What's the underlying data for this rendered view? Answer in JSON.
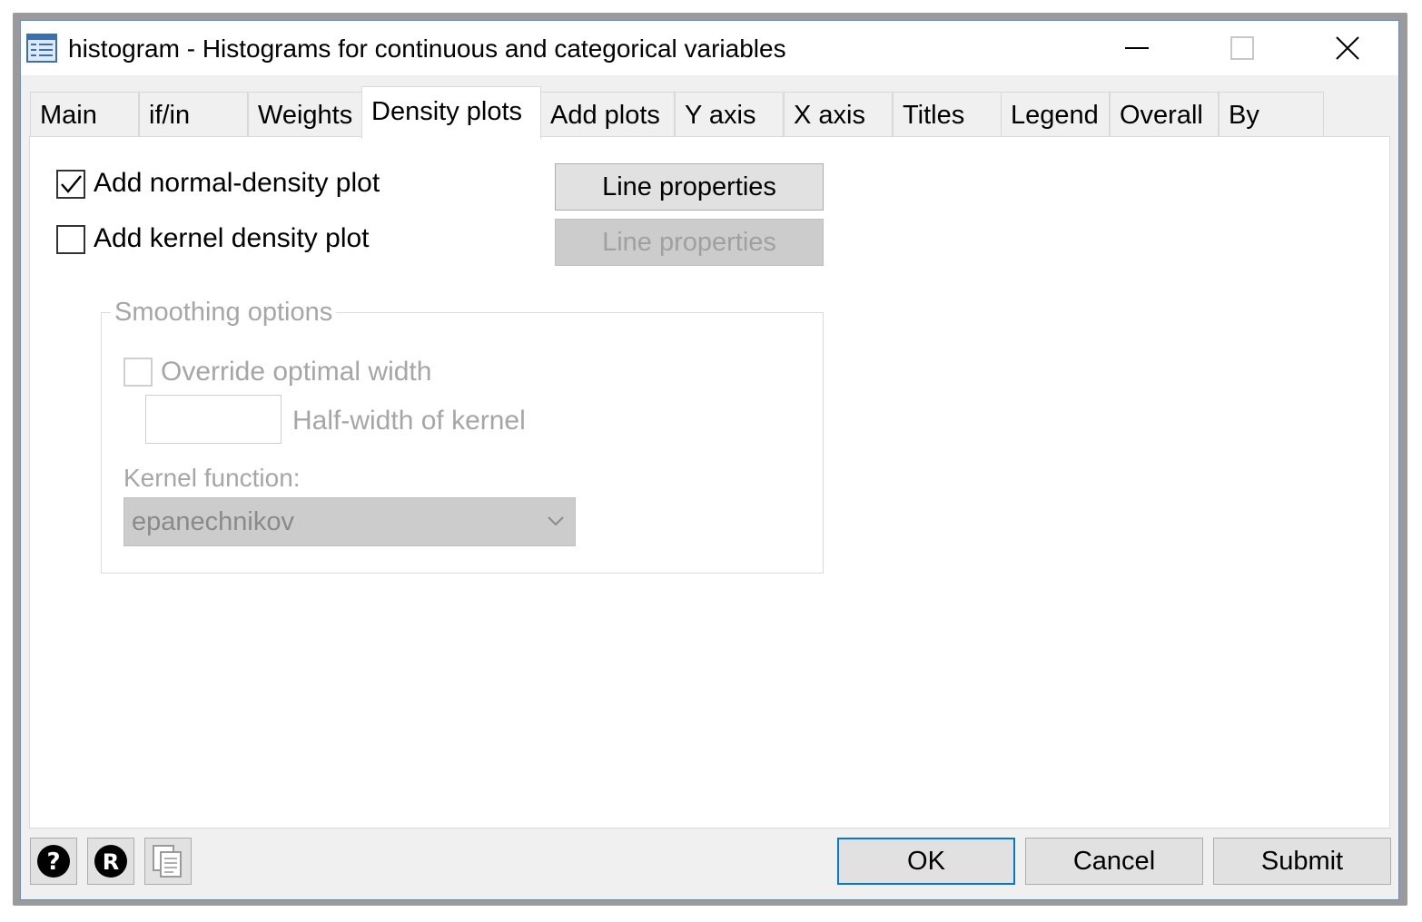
{
  "window": {
    "title": "histogram - Histograms for continuous and categorical variables"
  },
  "tabs": [
    {
      "label": "Main"
    },
    {
      "label": "if/in"
    },
    {
      "label": "Weights"
    },
    {
      "label": "Density plots",
      "active": true
    },
    {
      "label": "Add plots"
    },
    {
      "label": "Y axis"
    },
    {
      "label": "X axis"
    },
    {
      "label": "Titles"
    },
    {
      "label": "Legend"
    },
    {
      "label": "Overall"
    },
    {
      "label": "By"
    }
  ],
  "density": {
    "normal": {
      "label": "Add normal-density plot",
      "checked": true,
      "button": "Line properties"
    },
    "kernel": {
      "label": "Add kernel density plot",
      "checked": false,
      "button": "Line properties"
    },
    "smoothing": {
      "legend": "Smoothing options",
      "override_label": "Override optimal width",
      "override_checked": false,
      "halfwidth_label": "Half-width of kernel",
      "halfwidth_value": "",
      "kernel_label": "Kernel function:",
      "kernel_value": "epanechnikov"
    }
  },
  "footer": {
    "help_icon": "question-icon",
    "reset_icon": "r-circle-icon",
    "copy_icon": "copy-icon",
    "ok": "OK",
    "cancel": "Cancel",
    "submit": "Submit"
  },
  "colors": {
    "accent": "#0078d7",
    "window_border": "#5b8fd6"
  }
}
